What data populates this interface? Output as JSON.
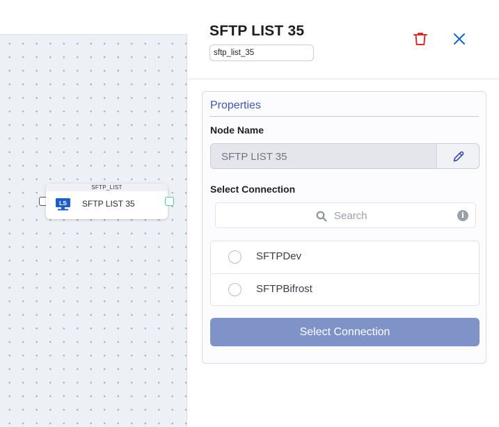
{
  "canvas": {
    "node": {
      "type_label": "SFTP_LIST",
      "icon_text": "LS",
      "icon": "list-sftp-icon",
      "name": "SFTP LIST 35"
    }
  },
  "panel": {
    "title": "SFTP LIST 35",
    "node_id": "sftp_list_35",
    "delete_icon": "trash-icon",
    "close_icon": "close-icon",
    "properties": {
      "heading": "Properties",
      "node_name_label": "Node Name",
      "node_name_value": "SFTP LIST 35",
      "edit_icon": "pencil-icon",
      "select_connection_label": "Select Connection",
      "search_placeholder": "Search",
      "connections": [
        {
          "label": "SFTPDev",
          "selected": false
        },
        {
          "label": "SFTPBifrost",
          "selected": false
        }
      ],
      "select_button_label": "Select Connection"
    }
  },
  "colors": {
    "accent": "#3e57a8",
    "button": "#7f93c8",
    "delete": "#d32f2f",
    "close": "#1565c0",
    "port_out": "#4ccba0"
  }
}
